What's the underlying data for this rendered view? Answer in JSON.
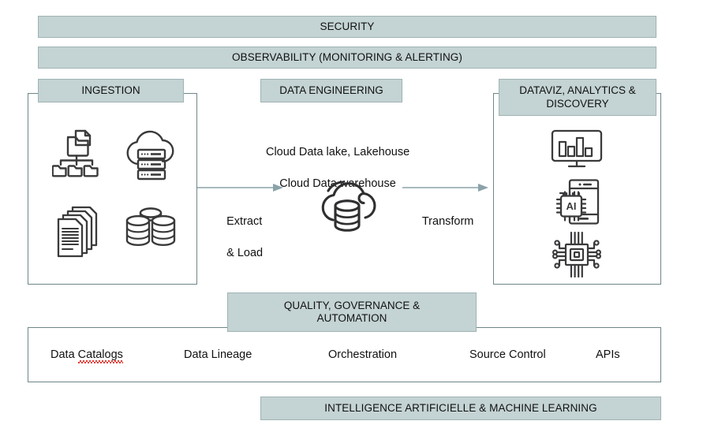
{
  "diagram": {
    "title": "Data Platform Architecture",
    "colors": {
      "banner_fill": "#c4d3d3",
      "banner_border": "#9fb3b5",
      "panel_border": "#6e8689",
      "arrow": "#8ba3a8",
      "icon_stroke": "#3a3a3c",
      "text": "#111111",
      "spellcheck_underline": "#e8352e",
      "background": "#ffffff"
    },
    "top_banners": [
      {
        "label": "SECURITY"
      },
      {
        "label": "OBSERVABILITY (MONITORING & ALERTING)"
      }
    ],
    "bottom_banner": {
      "label": "INTELLIGENCE ARTIFICIELLE & MACHINE LEARNING"
    },
    "columns": {
      "ingestion": {
        "header": "INGESTION",
        "icons": [
          {
            "name": "folder-hierarchy-icon",
            "caption": ""
          },
          {
            "name": "cloud-servers-icon",
            "caption": ""
          },
          {
            "name": "stacked-documents-icon",
            "caption": ""
          },
          {
            "name": "database-stack-icon",
            "caption": ""
          }
        ]
      },
      "data_engineering": {
        "header": "DATA ENGINEERING",
        "description_line1": "Cloud Data lake, Lakehouse",
        "description_line2": "Cloud Data warehouse",
        "icon": {
          "name": "cloud-database-icon"
        }
      },
      "dataviz": {
        "header": "DATAVIZ, ANALYTICS & DISCOVERY",
        "header_line1": "DATAVIZ, ANALYTICS &",
        "header_line2": "DISCOVERY",
        "icons": [
          {
            "name": "monitor-bar-chart-icon"
          },
          {
            "name": "phone-ai-chip-icon",
            "chip_label": "AI"
          },
          {
            "name": "microchip-circuit-icon"
          }
        ]
      }
    },
    "arrows": [
      {
        "name": "extract-load-arrow",
        "label_line1": "Extract",
        "label_line2": "& Load"
      },
      {
        "name": "transform-arrow",
        "label_line1": "Transform",
        "label_line2": ""
      }
    ],
    "governance": {
      "header_line1": "QUALITY, GOVERNANCE &",
      "header_line2": "AUTOMATION",
      "header": "QUALITY, GOVERNANCE & AUTOMATION",
      "items": [
        {
          "label": "Data Catalogs",
          "prefix": "Data ",
          "misspelled": "Catalogs",
          "spellcheck": true
        },
        {
          "label": "Data Lineage",
          "spellcheck": false
        },
        {
          "label": "Orchestration",
          "spellcheck": false
        },
        {
          "label": "Source Control",
          "spellcheck": false
        },
        {
          "label": "APIs",
          "spellcheck": false
        }
      ]
    }
  }
}
